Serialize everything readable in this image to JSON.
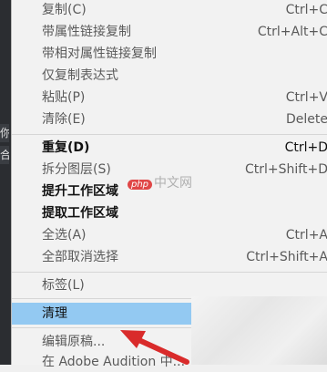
{
  "background_stubs": [
    "你",
    "合"
  ],
  "menu": {
    "items": [
      {
        "label": "复制(C)",
        "shortcut": "Ctrl+C",
        "strong": false
      },
      {
        "label": "带属性链接复制",
        "shortcut": "Ctrl+Alt+C",
        "strong": false
      },
      {
        "label": "带相对属性链接复制",
        "shortcut": "",
        "strong": false
      },
      {
        "label": "仅复制表达式",
        "shortcut": "",
        "strong": false
      },
      {
        "label": "粘贴(P)",
        "shortcut": "Ctrl+V",
        "strong": false
      },
      {
        "label": "清除(E)",
        "shortcut": "Delete",
        "strong": false
      },
      {
        "label": "重复(D)",
        "shortcut": "Ctrl+D",
        "strong": true
      },
      {
        "label": "拆分图层(S)",
        "shortcut": "Ctrl+Shift+D",
        "strong": false
      },
      {
        "label": "提升工作区域",
        "shortcut": "",
        "strong": true
      },
      {
        "label": "提取工作区域",
        "shortcut": "",
        "strong": true
      },
      {
        "label": "全选(A)",
        "shortcut": "Ctrl+A",
        "strong": false
      },
      {
        "label": "全部取消选择",
        "shortcut": "Ctrl+Shift+A",
        "strong": false
      },
      {
        "label": "标签(L)",
        "shortcut": "",
        "strong": false
      },
      {
        "label": "清理",
        "shortcut": "",
        "strong": true,
        "highlighted": true
      },
      {
        "label": "编辑原稿...",
        "shortcut": "",
        "strong": false
      },
      {
        "label": "在 Adobe Audition 中...",
        "shortcut": "",
        "strong": false
      }
    ]
  },
  "watermark": {
    "badge": "php",
    "text": "中文网"
  },
  "colors": {
    "highlight": "#93c9f2",
    "arrow": "#d92b2b"
  }
}
